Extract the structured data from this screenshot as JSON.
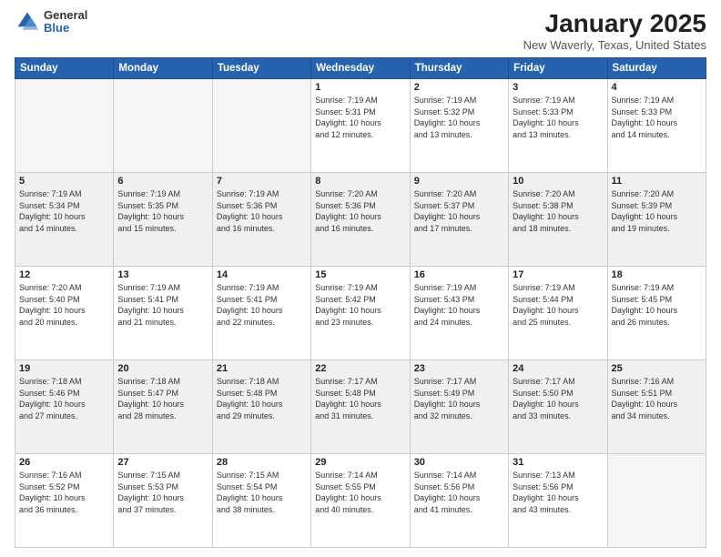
{
  "logo": {
    "general": "General",
    "blue": "Blue"
  },
  "title": {
    "month": "January 2025",
    "location": "New Waverly, Texas, United States"
  },
  "weekdays": [
    "Sunday",
    "Monday",
    "Tuesday",
    "Wednesday",
    "Thursday",
    "Friday",
    "Saturday"
  ],
  "weeks": [
    {
      "shaded": false,
      "days": [
        {
          "num": "",
          "info": "",
          "empty": true
        },
        {
          "num": "",
          "info": "",
          "empty": true
        },
        {
          "num": "",
          "info": "",
          "empty": true
        },
        {
          "num": "1",
          "info": "Sunrise: 7:19 AM\nSunset: 5:31 PM\nDaylight: 10 hours\nand 12 minutes.",
          "empty": false
        },
        {
          "num": "2",
          "info": "Sunrise: 7:19 AM\nSunset: 5:32 PM\nDaylight: 10 hours\nand 13 minutes.",
          "empty": false
        },
        {
          "num": "3",
          "info": "Sunrise: 7:19 AM\nSunset: 5:33 PM\nDaylight: 10 hours\nand 13 minutes.",
          "empty": false
        },
        {
          "num": "4",
          "info": "Sunrise: 7:19 AM\nSunset: 5:33 PM\nDaylight: 10 hours\nand 14 minutes.",
          "empty": false
        }
      ]
    },
    {
      "shaded": true,
      "days": [
        {
          "num": "5",
          "info": "Sunrise: 7:19 AM\nSunset: 5:34 PM\nDaylight: 10 hours\nand 14 minutes.",
          "empty": false
        },
        {
          "num": "6",
          "info": "Sunrise: 7:19 AM\nSunset: 5:35 PM\nDaylight: 10 hours\nand 15 minutes.",
          "empty": false
        },
        {
          "num": "7",
          "info": "Sunrise: 7:19 AM\nSunset: 5:36 PM\nDaylight: 10 hours\nand 16 minutes.",
          "empty": false
        },
        {
          "num": "8",
          "info": "Sunrise: 7:20 AM\nSunset: 5:36 PM\nDaylight: 10 hours\nand 16 minutes.",
          "empty": false
        },
        {
          "num": "9",
          "info": "Sunrise: 7:20 AM\nSunset: 5:37 PM\nDaylight: 10 hours\nand 17 minutes.",
          "empty": false
        },
        {
          "num": "10",
          "info": "Sunrise: 7:20 AM\nSunset: 5:38 PM\nDaylight: 10 hours\nand 18 minutes.",
          "empty": false
        },
        {
          "num": "11",
          "info": "Sunrise: 7:20 AM\nSunset: 5:39 PM\nDaylight: 10 hours\nand 19 minutes.",
          "empty": false
        }
      ]
    },
    {
      "shaded": false,
      "days": [
        {
          "num": "12",
          "info": "Sunrise: 7:20 AM\nSunset: 5:40 PM\nDaylight: 10 hours\nand 20 minutes.",
          "empty": false
        },
        {
          "num": "13",
          "info": "Sunrise: 7:19 AM\nSunset: 5:41 PM\nDaylight: 10 hours\nand 21 minutes.",
          "empty": false
        },
        {
          "num": "14",
          "info": "Sunrise: 7:19 AM\nSunset: 5:41 PM\nDaylight: 10 hours\nand 22 minutes.",
          "empty": false
        },
        {
          "num": "15",
          "info": "Sunrise: 7:19 AM\nSunset: 5:42 PM\nDaylight: 10 hours\nand 23 minutes.",
          "empty": false
        },
        {
          "num": "16",
          "info": "Sunrise: 7:19 AM\nSunset: 5:43 PM\nDaylight: 10 hours\nand 24 minutes.",
          "empty": false
        },
        {
          "num": "17",
          "info": "Sunrise: 7:19 AM\nSunset: 5:44 PM\nDaylight: 10 hours\nand 25 minutes.",
          "empty": false
        },
        {
          "num": "18",
          "info": "Sunrise: 7:19 AM\nSunset: 5:45 PM\nDaylight: 10 hours\nand 26 minutes.",
          "empty": false
        }
      ]
    },
    {
      "shaded": true,
      "days": [
        {
          "num": "19",
          "info": "Sunrise: 7:18 AM\nSunset: 5:46 PM\nDaylight: 10 hours\nand 27 minutes.",
          "empty": false
        },
        {
          "num": "20",
          "info": "Sunrise: 7:18 AM\nSunset: 5:47 PM\nDaylight: 10 hours\nand 28 minutes.",
          "empty": false
        },
        {
          "num": "21",
          "info": "Sunrise: 7:18 AM\nSunset: 5:48 PM\nDaylight: 10 hours\nand 29 minutes.",
          "empty": false
        },
        {
          "num": "22",
          "info": "Sunrise: 7:17 AM\nSunset: 5:48 PM\nDaylight: 10 hours\nand 31 minutes.",
          "empty": false
        },
        {
          "num": "23",
          "info": "Sunrise: 7:17 AM\nSunset: 5:49 PM\nDaylight: 10 hours\nand 32 minutes.",
          "empty": false
        },
        {
          "num": "24",
          "info": "Sunrise: 7:17 AM\nSunset: 5:50 PM\nDaylight: 10 hours\nand 33 minutes.",
          "empty": false
        },
        {
          "num": "25",
          "info": "Sunrise: 7:16 AM\nSunset: 5:51 PM\nDaylight: 10 hours\nand 34 minutes.",
          "empty": false
        }
      ]
    },
    {
      "shaded": false,
      "days": [
        {
          "num": "26",
          "info": "Sunrise: 7:16 AM\nSunset: 5:52 PM\nDaylight: 10 hours\nand 36 minutes.",
          "empty": false
        },
        {
          "num": "27",
          "info": "Sunrise: 7:15 AM\nSunset: 5:53 PM\nDaylight: 10 hours\nand 37 minutes.",
          "empty": false
        },
        {
          "num": "28",
          "info": "Sunrise: 7:15 AM\nSunset: 5:54 PM\nDaylight: 10 hours\nand 38 minutes.",
          "empty": false
        },
        {
          "num": "29",
          "info": "Sunrise: 7:14 AM\nSunset: 5:55 PM\nDaylight: 10 hours\nand 40 minutes.",
          "empty": false
        },
        {
          "num": "30",
          "info": "Sunrise: 7:14 AM\nSunset: 5:56 PM\nDaylight: 10 hours\nand 41 minutes.",
          "empty": false
        },
        {
          "num": "31",
          "info": "Sunrise: 7:13 AM\nSunset: 5:56 PM\nDaylight: 10 hours\nand 43 minutes.",
          "empty": false
        },
        {
          "num": "",
          "info": "",
          "empty": true
        }
      ]
    }
  ]
}
